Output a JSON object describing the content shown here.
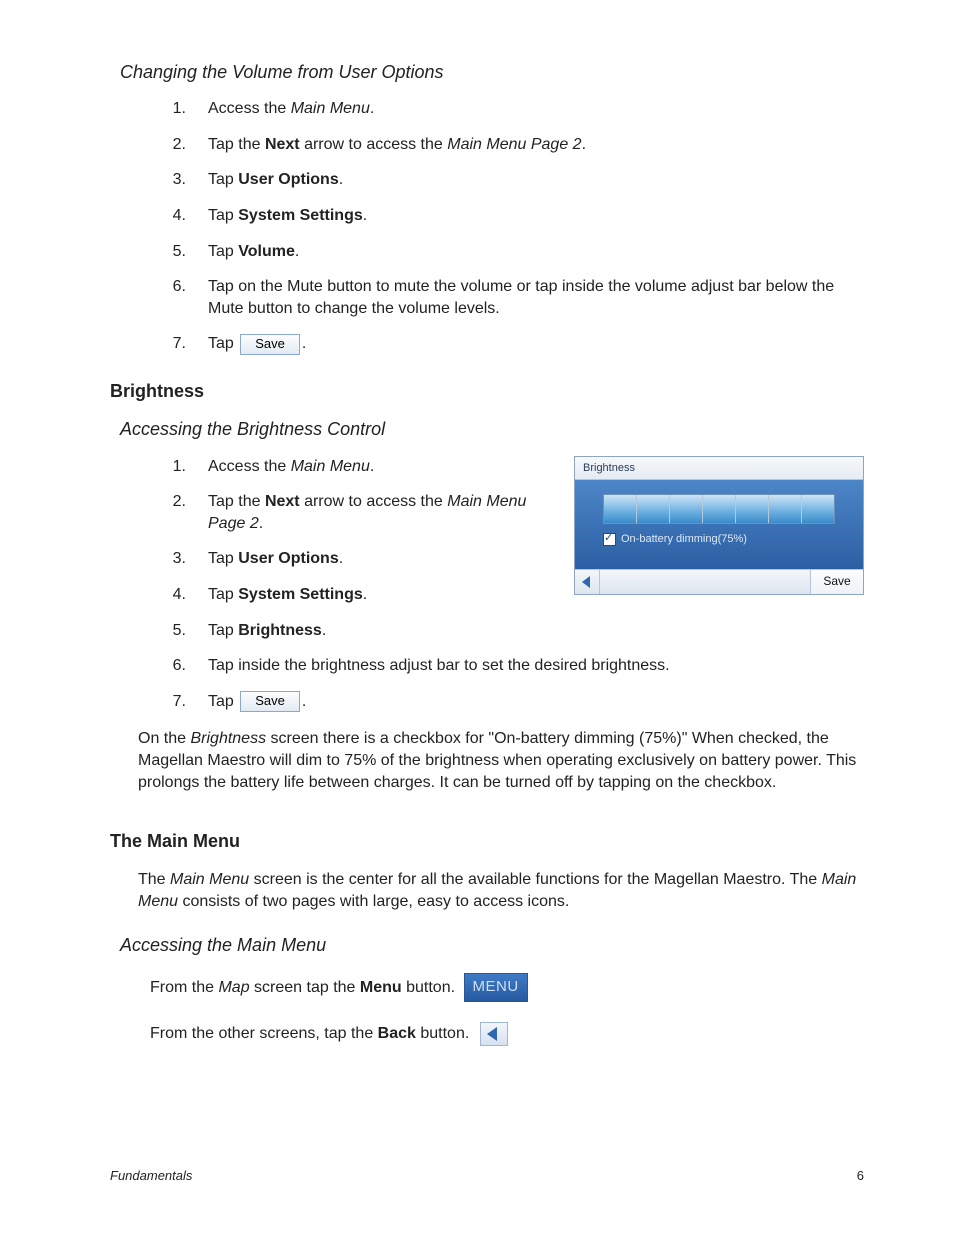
{
  "sec1": {
    "heading": "Changing the Volume from User Options",
    "steps": [
      {
        "n": "1.",
        "runs": [
          {
            "t": "Access the "
          },
          {
            "t": "Main Menu",
            "i": true
          },
          {
            "t": "."
          }
        ]
      },
      {
        "n": "2.",
        "runs": [
          {
            "t": "Tap the "
          },
          {
            "t": "Next",
            "b": true
          },
          {
            "t": " arrow to access the "
          },
          {
            "t": "Main Menu Page 2",
            "i": true
          },
          {
            "t": "."
          }
        ]
      },
      {
        "n": "3.",
        "runs": [
          {
            "t": "Tap "
          },
          {
            "t": "User Options",
            "b": true
          },
          {
            "t": "."
          }
        ]
      },
      {
        "n": "4.",
        "runs": [
          {
            "t": "Tap "
          },
          {
            "t": "System Settings",
            "b": true
          },
          {
            "t": "."
          }
        ]
      },
      {
        "n": "5.",
        "runs": [
          {
            "t": "Tap "
          },
          {
            "t": "Volume",
            "b": true
          },
          {
            "t": "."
          }
        ]
      },
      {
        "n": "6.",
        "runs": [
          {
            "t": "Tap on the Mute button to mute the volume or tap inside the volume adjust bar below the Mute button to change the volume levels."
          }
        ]
      },
      {
        "n": "7.",
        "runs": [
          {
            "t": "Tap "
          },
          {
            "btn": "save"
          },
          {
            "t": "."
          }
        ]
      }
    ]
  },
  "sec2": {
    "heading": "Brightness",
    "sub": "Accessing the Brightness Control",
    "steps_top": [
      {
        "n": "1.",
        "runs": [
          {
            "t": "Access the "
          },
          {
            "t": "Main Menu",
            "i": true
          },
          {
            "t": "."
          }
        ]
      },
      {
        "n": "2.",
        "runs": [
          {
            "t": "Tap the "
          },
          {
            "t": "Next",
            "b": true
          },
          {
            "t": " arrow to access the "
          },
          {
            "t": "Main Menu Page 2",
            "i": true
          },
          {
            "t": "."
          }
        ]
      },
      {
        "n": "3.",
        "runs": [
          {
            "t": "Tap "
          },
          {
            "t": "User Options",
            "b": true
          },
          {
            "t": "."
          }
        ]
      },
      {
        "n": "4.",
        "runs": [
          {
            "t": "Tap "
          },
          {
            "t": "System Settings",
            "b": true
          },
          {
            "t": "."
          }
        ]
      }
    ],
    "steps_bottom": [
      {
        "n": "5.",
        "runs": [
          {
            "t": "Tap "
          },
          {
            "t": "Brightness",
            "b": true
          },
          {
            "t": "."
          }
        ]
      },
      {
        "n": "6.",
        "runs": [
          {
            "t": "Tap inside the brightness adjust bar to set the desired brightness."
          }
        ]
      },
      {
        "n": "7.",
        "runs": [
          {
            "t": "Tap "
          },
          {
            "btn": "save"
          },
          {
            "t": "."
          }
        ]
      }
    ],
    "screen": {
      "title": "Brightness",
      "checkbox": "On-battery dimming(75%)",
      "save": "Save",
      "segments": 7
    },
    "para_runs": [
      {
        "t": "On the "
      },
      {
        "t": "Brightness",
        "i": true
      },
      {
        "t": " screen there is a checkbox for \"On-battery dimming (75%)\"  When checked, the Magellan Maestro will dim to 75% of the brightness when operating exclusively on battery power.  This prolongs the battery life between charges.  It can be turned off by tapping on the checkbox."
      }
    ]
  },
  "sec3": {
    "heading": "The Main Menu",
    "para_runs": [
      {
        "t": "The "
      },
      {
        "t": "Main Menu",
        "i": true
      },
      {
        "t": " screen is the center for all the available functions for the Magellan Maestro.  The "
      },
      {
        "t": "Main Menu",
        "i": true
      },
      {
        "t": " consists of two pages with large, easy to access icons."
      }
    ],
    "sub": "Accessing the Main Menu",
    "line1_runs": [
      {
        "t": "From the "
      },
      {
        "t": "Map",
        "i": true
      },
      {
        "t": " screen tap the "
      },
      {
        "t": "Menu",
        "b": true
      },
      {
        "t": " button. "
      },
      {
        "btn": "menu"
      }
    ],
    "line2_runs": [
      {
        "t": "From the other screens, tap the "
      },
      {
        "t": "Back",
        "b": true
      },
      {
        "t": " button.  "
      },
      {
        "btn": "back"
      }
    ]
  },
  "buttons": {
    "save": "Save",
    "menu": "MENU"
  },
  "footer": {
    "title": "Fundamentals",
    "page": "6"
  }
}
